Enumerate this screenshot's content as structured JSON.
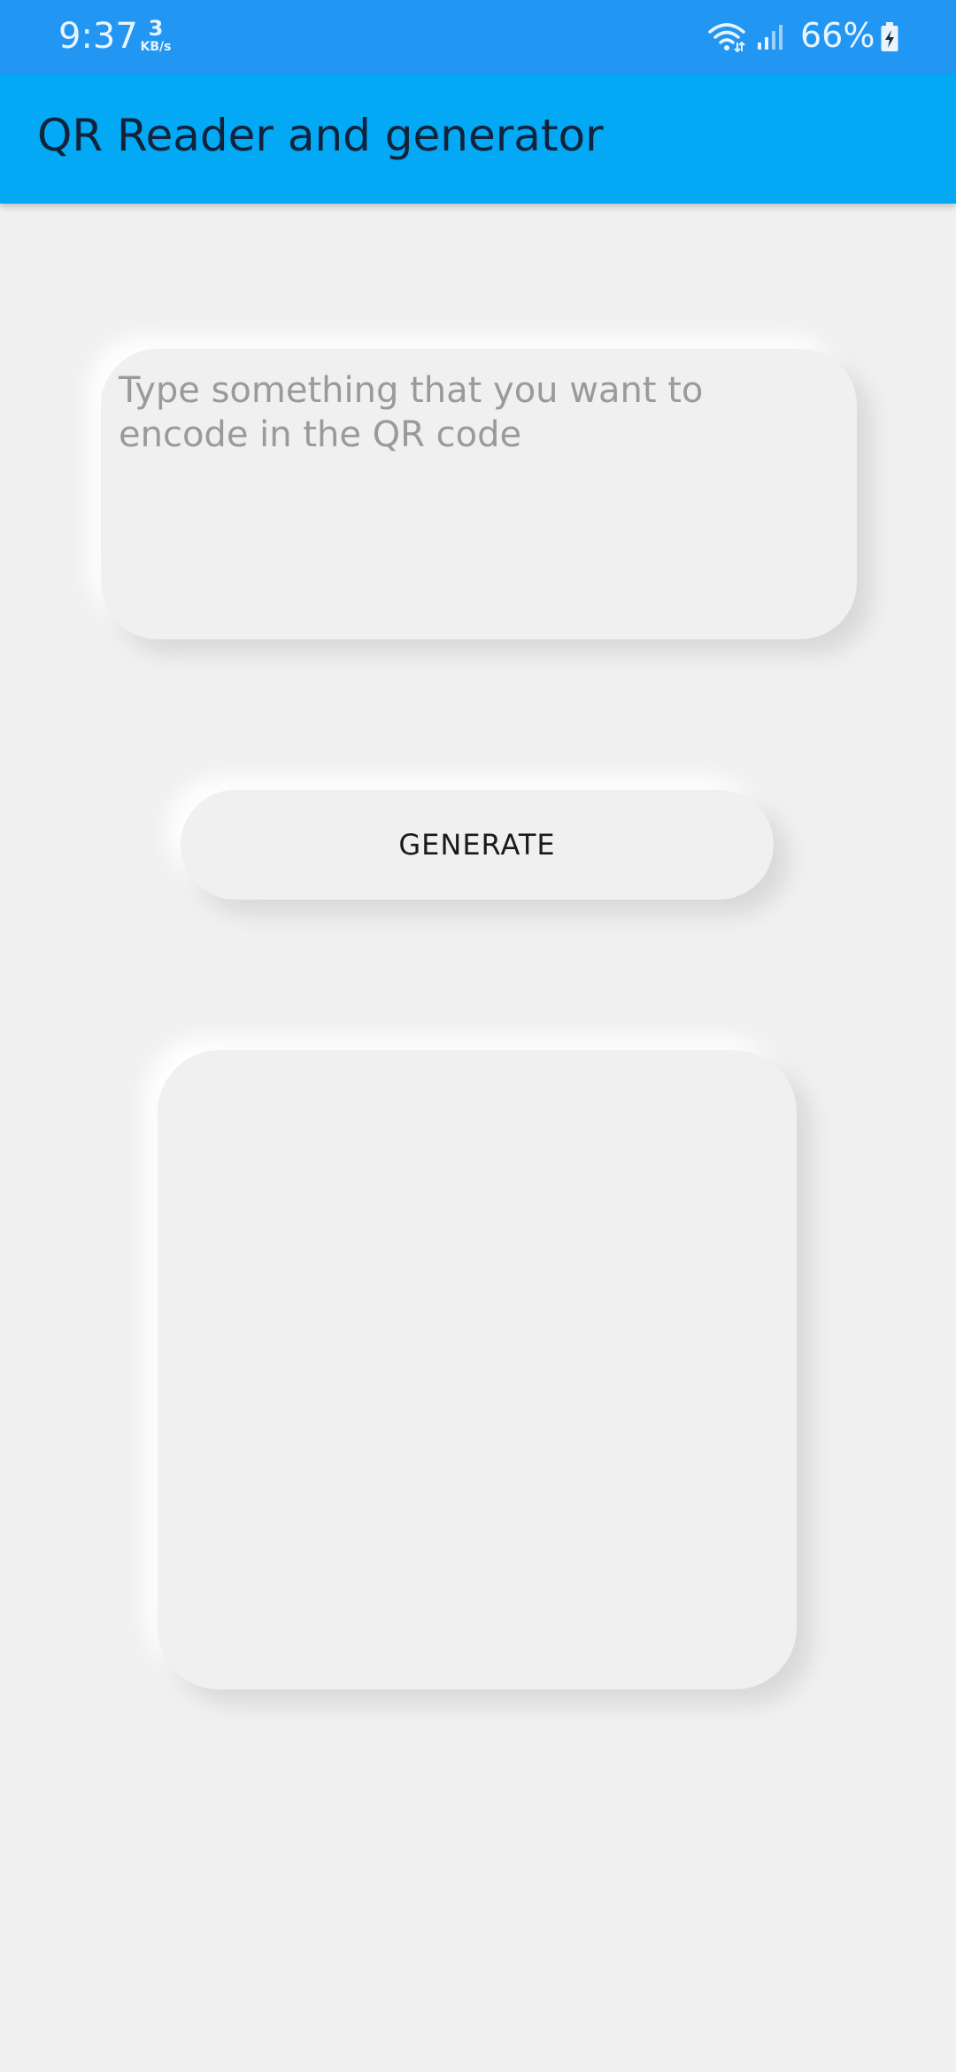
{
  "status_bar": {
    "time": "9:37",
    "net_speed_value": "3",
    "net_speed_unit": "KB/s",
    "battery_percent": "66%",
    "icons": [
      "wifi-icon",
      "signal-icon",
      "battery-charging-icon"
    ],
    "color": "#2196f3"
  },
  "app_bar": {
    "title": "QR Reader and generator",
    "color": "#03a9f4"
  },
  "encode_input": {
    "value": "",
    "placeholder": "Type something that you want to encode in the QR code"
  },
  "generate_button": {
    "label": "GENERATE"
  },
  "colors": {
    "background": "#f0f0f0",
    "title_text": "#10233a",
    "placeholder_text": "#9a9a9a"
  }
}
